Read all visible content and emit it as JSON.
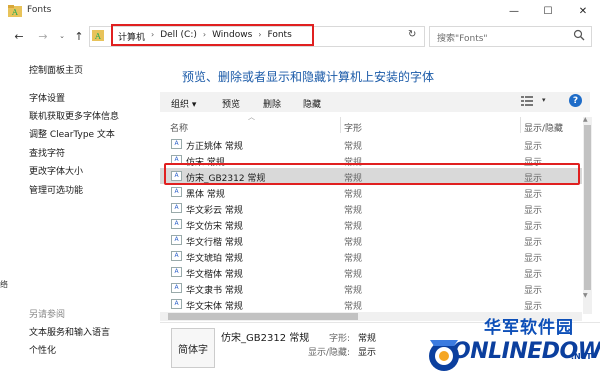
{
  "window": {
    "title": "Fonts",
    "controls": {
      "minimize": "—",
      "maximize": "☐",
      "close": "✕"
    }
  },
  "nav": {
    "back": "←",
    "forward": "→",
    "recent": "⌄",
    "up": "↑",
    "refresh": "↻"
  },
  "address": {
    "breadcrumbs": [
      "计算机",
      "Dell (C:)",
      "Windows",
      "Fonts"
    ],
    "separator": "›"
  },
  "search": {
    "placeholder": "搜索\"Fonts\""
  },
  "left_pane": {
    "links": [
      "控制面板主页",
      "字体设置",
      "联机获取更多字体信息",
      "调整 ClearType 文本",
      "查找字符",
      "更改字体大小",
      "管理可选功能"
    ],
    "see_also_label": "另请参阅",
    "see_also": [
      "文本服务和输入语言",
      "个性化"
    ],
    "strip_text": "络"
  },
  "main": {
    "heading": "预览、删除或者显示和隐藏计算机上安装的字体",
    "toolbar": {
      "organize": "组织 ▾",
      "preview": "预览",
      "delete": "删除",
      "hide": "隐藏",
      "view_arrow": "▾",
      "help": "?"
    },
    "columns": {
      "name": "名称",
      "style": "字形",
      "show_hide": "显示/隐藏"
    },
    "rows": [
      {
        "name": "方正姚体 常规",
        "style": "常规",
        "show": "显示"
      },
      {
        "name": "仿宋 常规",
        "style": "常规",
        "show": "显示"
      },
      {
        "name": "仿宋_GB2312 常规",
        "style": "常规",
        "show": "显示",
        "selected": true
      },
      {
        "name": "黑体 常规",
        "style": "常规",
        "show": "显示"
      },
      {
        "name": "华文彩云 常规",
        "style": "常规",
        "show": "显示"
      },
      {
        "name": "华文仿宋 常规",
        "style": "常规",
        "show": "显示"
      },
      {
        "name": "华文行楷 常规",
        "style": "常规",
        "show": "显示"
      },
      {
        "name": "华文琥珀 常规",
        "style": "常规",
        "show": "显示"
      },
      {
        "name": "华文楷体 常规",
        "style": "常规",
        "show": "显示"
      },
      {
        "name": "华文隶书 常规",
        "style": "常规",
        "show": "显示"
      },
      {
        "name": "华文宋体 常规",
        "style": "常规",
        "show": "显示"
      }
    ]
  },
  "details": {
    "preview_text": "简体字",
    "name": "仿宋_GB2312 常规",
    "style_label": "字形:",
    "style_value": "常规",
    "show_label": "显示/隐藏:",
    "show_value": "显示"
  },
  "watermark": {
    "cn": "华军软件园",
    "en": "ONLINEDOWN",
    "suffix": ".NET"
  },
  "colors": {
    "accent": "#1a5aa8",
    "highlight": "#e02020",
    "selected_row": "#d9d9d9"
  }
}
